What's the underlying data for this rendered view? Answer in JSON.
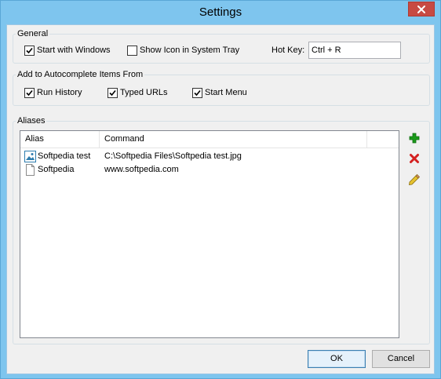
{
  "window": {
    "title": "Settings"
  },
  "general": {
    "label": "General",
    "start_with_windows": {
      "label": "Start with Windows",
      "checked": true
    },
    "show_icon_tray": {
      "label": "Show Icon in System Tray",
      "checked": false
    },
    "hotkey_label": "Hot Key:",
    "hotkey_value": "Ctrl + R"
  },
  "autocomplete": {
    "label": "Add to Autocomplete Items From",
    "run_history": {
      "label": "Run History",
      "checked": true
    },
    "typed_urls": {
      "label": "Typed URLs",
      "checked": true
    },
    "start_menu": {
      "label": "Start Menu",
      "checked": true
    }
  },
  "aliases": {
    "label": "Aliases",
    "columns": [
      "Alias",
      "Command"
    ],
    "rows": [
      {
        "alias": "Softpedia test",
        "command": "C:\\Softpedia Files\\Softpedia test.jpg",
        "icon": "image-file-icon"
      },
      {
        "alias": "Softpedia",
        "command": "www.softpedia.com",
        "icon": "blank-file-icon"
      }
    ],
    "add_icon": "plus-icon",
    "delete_icon": "delete-x-icon",
    "edit_icon": "pencil-icon"
  },
  "buttons": {
    "ok": "OK",
    "cancel": "Cancel"
  },
  "colors": {
    "frame": "#7ec5ee",
    "close": "#c74a43",
    "add": "#1a9a1a",
    "delete": "#d42020",
    "edit": "#e6c230"
  }
}
